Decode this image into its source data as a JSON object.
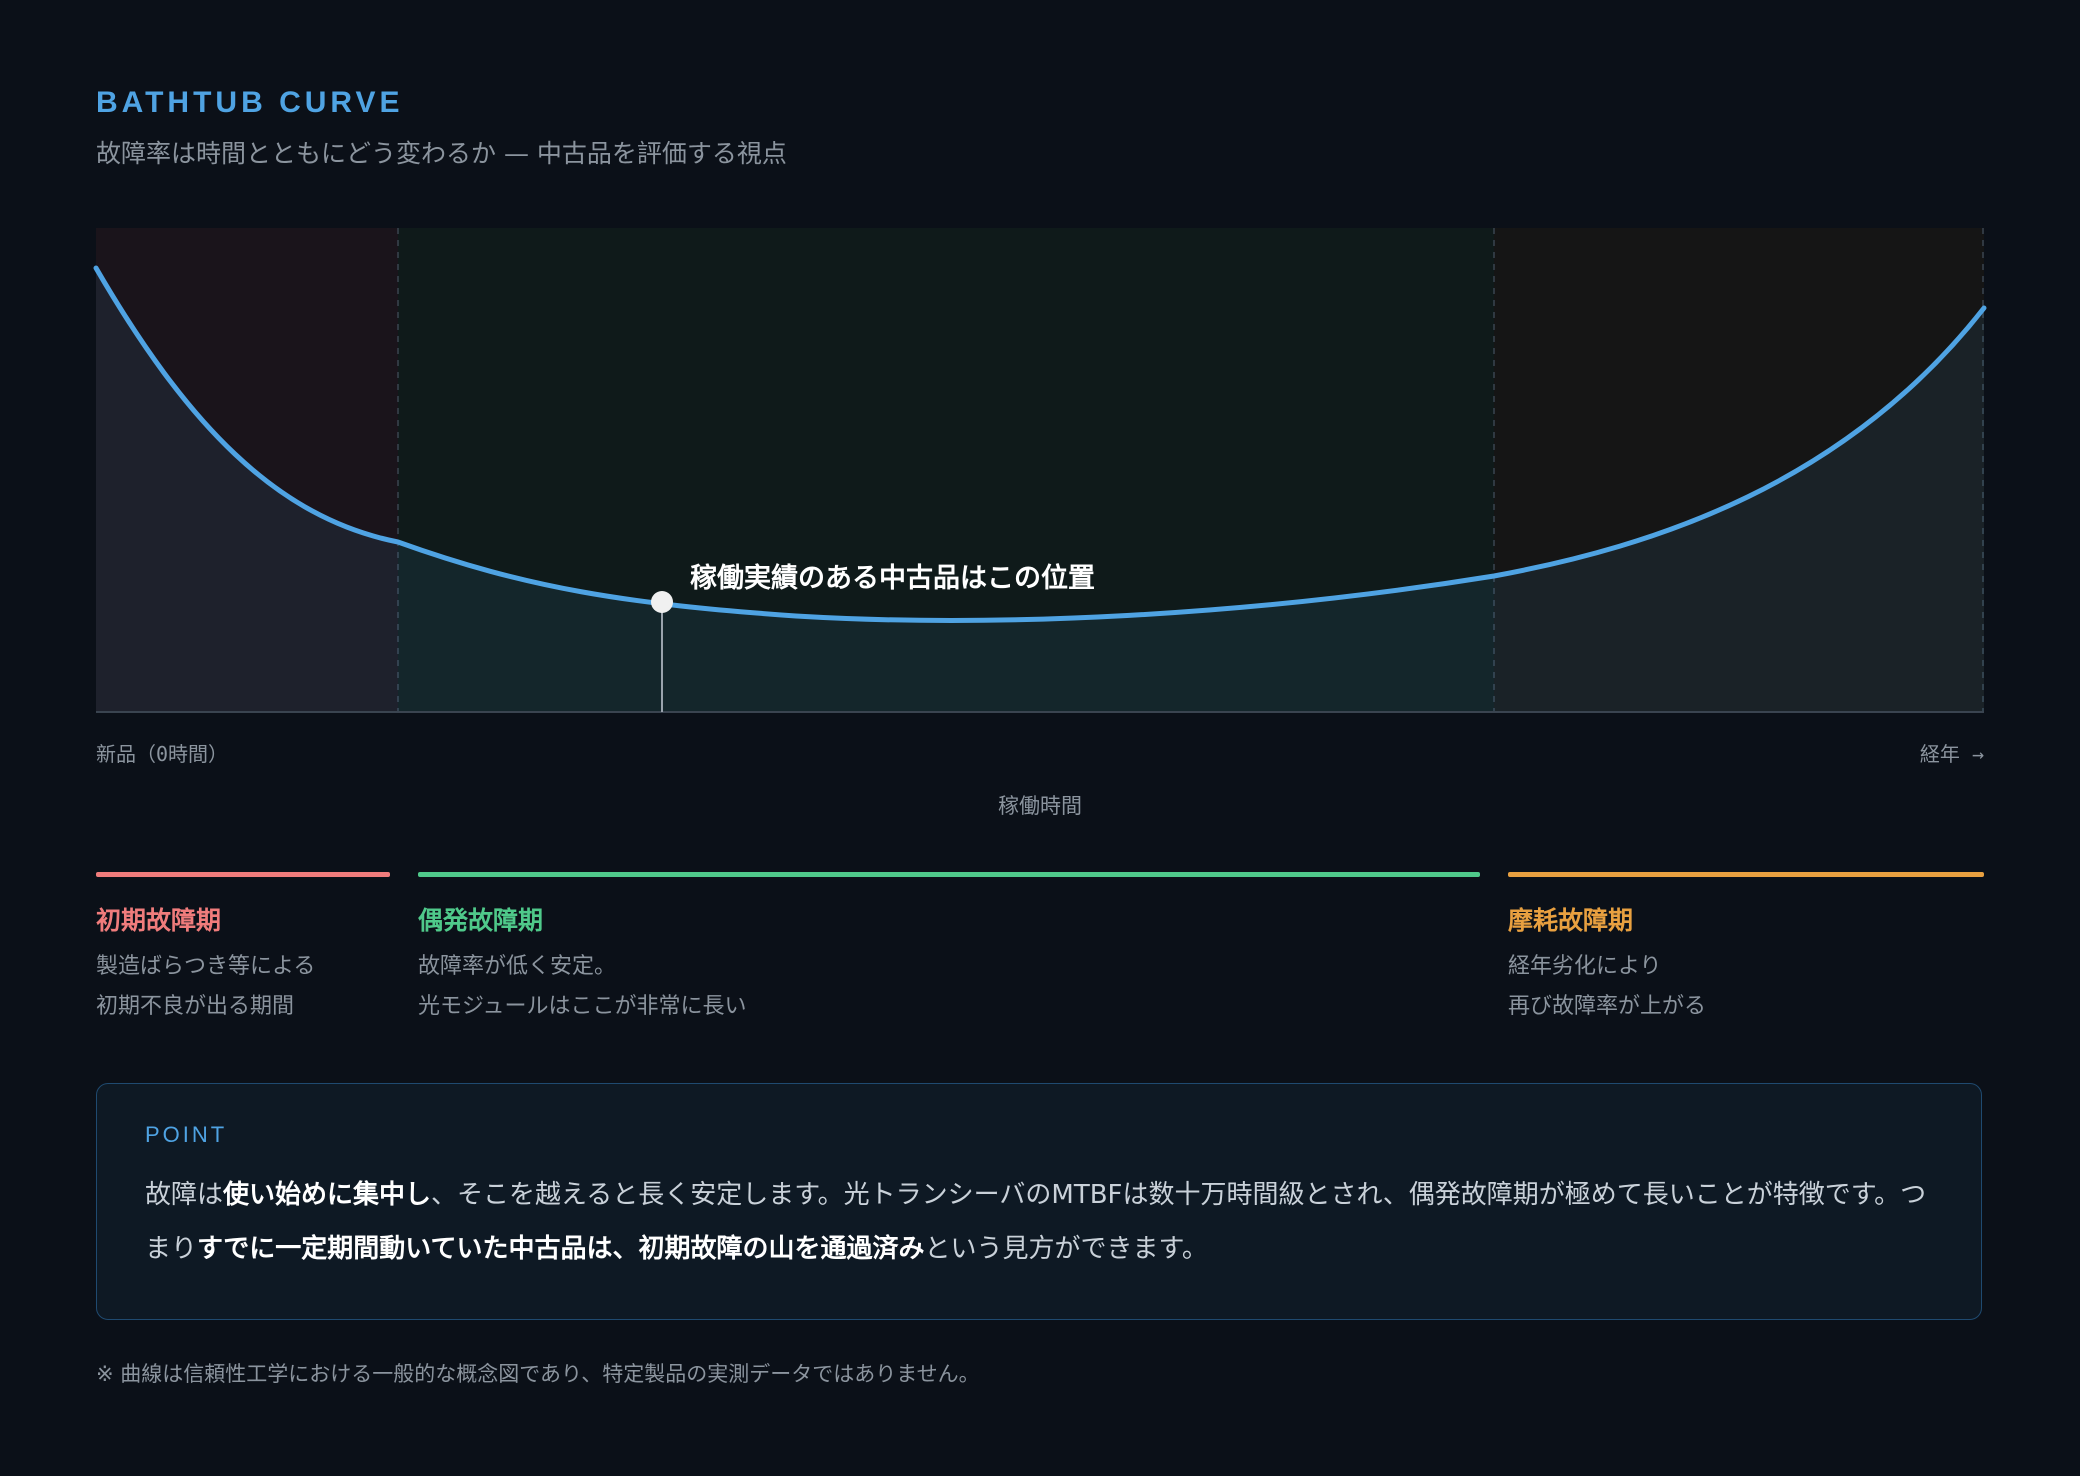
{
  "header": {
    "eyebrow": "BATHTUB CURVE",
    "subtitle": "故障率は時間とともにどう変わるか — 中古品を評価する視点"
  },
  "diagram": {
    "marker_label": "稼働実績のある中古品はこの位置",
    "axis_left": "新品（0時間）",
    "axis_right": "経年 →",
    "axis_title": "稼働時間",
    "curve_color": "#4fa3e3",
    "phase_fill_colors": [
      "#1a141b",
      "#0f1a1a",
      "#151515"
    ]
  },
  "phases": [
    {
      "name": "初期故障期",
      "color": "#f07c7c",
      "desc_line1": "製造ばらつき等による",
      "desc_line2": "初期不良が出る期間"
    },
    {
      "name": "偶発故障期",
      "color": "#4fc98a",
      "desc_line1": "故障率が低く安定。",
      "desc_line2": "光モジュールはここが非常に長い"
    },
    {
      "name": "摩耗故障期",
      "color": "#e8a040",
      "desc_line1": "経年劣化により",
      "desc_line2": "再び故障率が上がる"
    }
  ],
  "point": {
    "label": "POINT",
    "text1": "故障は",
    "bold1": "使い始めに集中し",
    "text2": "、そこを越えると長く安定します。光トランシーバのMTBFは数十万時間級とされ、偶発故障期が極めて長いことが特徴です。つまり",
    "bold2": "すでに一定期間動いていた中古品は、初期故障の山を通過済み",
    "text3": "という見方ができます。"
  },
  "footnote": "※ 曲線は信頼性工学における一般的な概念図であり、特定製品の実測データではありません。"
}
